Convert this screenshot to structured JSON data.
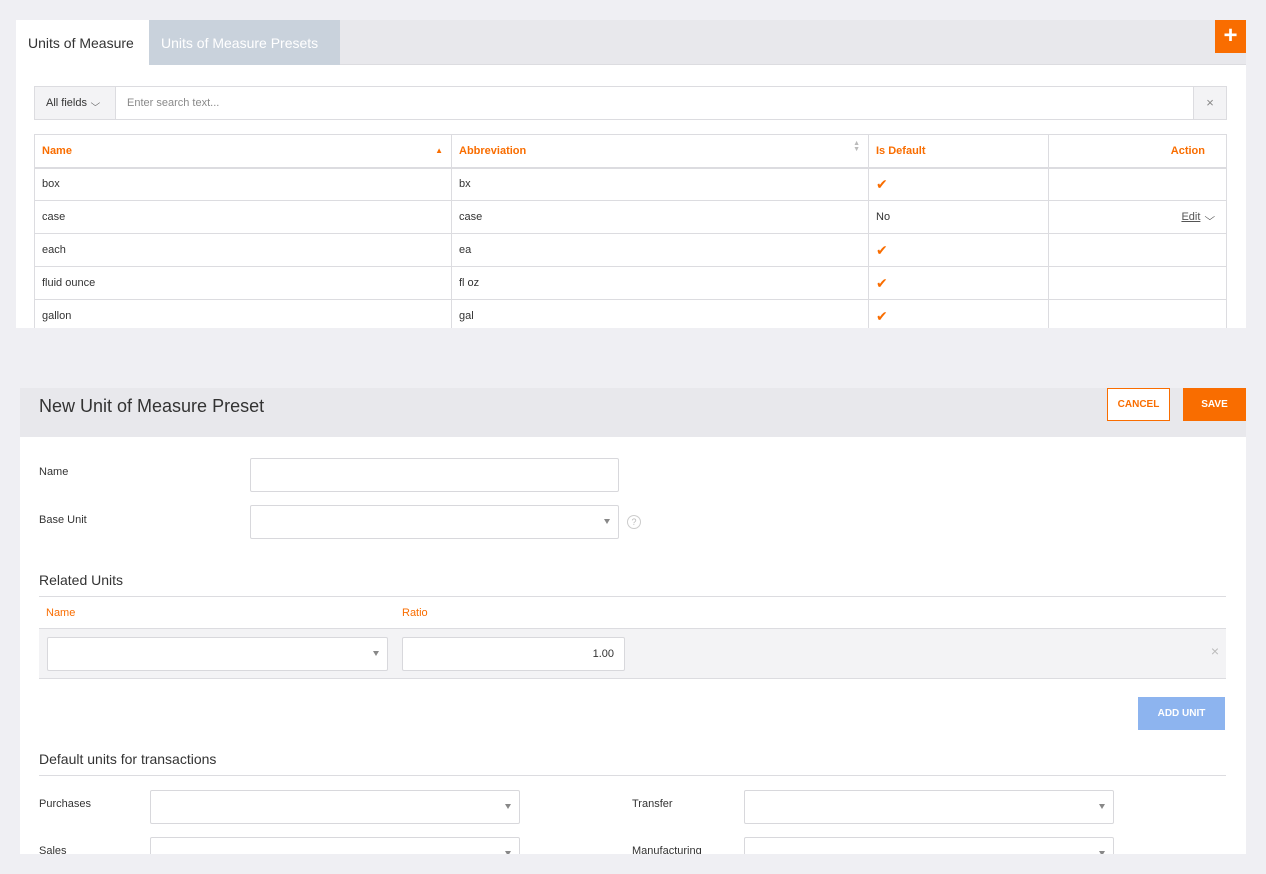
{
  "tabs": {
    "active": "Units of Measure",
    "inactive": "Units of Measure Presets"
  },
  "add_button": "+",
  "search": {
    "field_select": "All fields",
    "placeholder": "Enter search text...",
    "clear": "×"
  },
  "table": {
    "columns": {
      "name": "Name",
      "abbreviation": "Abbreviation",
      "is_default": "Is Default",
      "action": "Action"
    },
    "rows": [
      {
        "name": "box",
        "abbreviation": "bx",
        "is_default": "check",
        "action": ""
      },
      {
        "name": "case",
        "abbreviation": "case",
        "is_default": "No",
        "action": "Edit"
      },
      {
        "name": "each",
        "abbreviation": "ea",
        "is_default": "check",
        "action": ""
      },
      {
        "name": "fluid ounce",
        "abbreviation": "fl oz",
        "is_default": "check",
        "action": ""
      },
      {
        "name": "gallon",
        "abbreviation": "gal",
        "is_default": "check",
        "action": ""
      }
    ]
  },
  "form": {
    "title": "New Unit of Measure Preset",
    "cancel": "CANCEL",
    "save": "SAVE",
    "name_label": "Name",
    "name_value": "",
    "base_unit_label": "Base Unit",
    "base_unit_value": "",
    "related_units": {
      "title": "Related Units",
      "col_name": "Name",
      "col_ratio": "Ratio",
      "row": {
        "name": "",
        "ratio": "1.00"
      },
      "add_unit": "ADD UNIT"
    },
    "defaults": {
      "title": "Default units for transactions",
      "purchases": "Purchases",
      "transfer": "Transfer",
      "sales": "Sales",
      "manufacturing": "Manufacturing"
    }
  },
  "colors": {
    "accent": "#f96d00",
    "add_unit": "#8db4ef",
    "tab_inactive": "#c9d2dc"
  }
}
